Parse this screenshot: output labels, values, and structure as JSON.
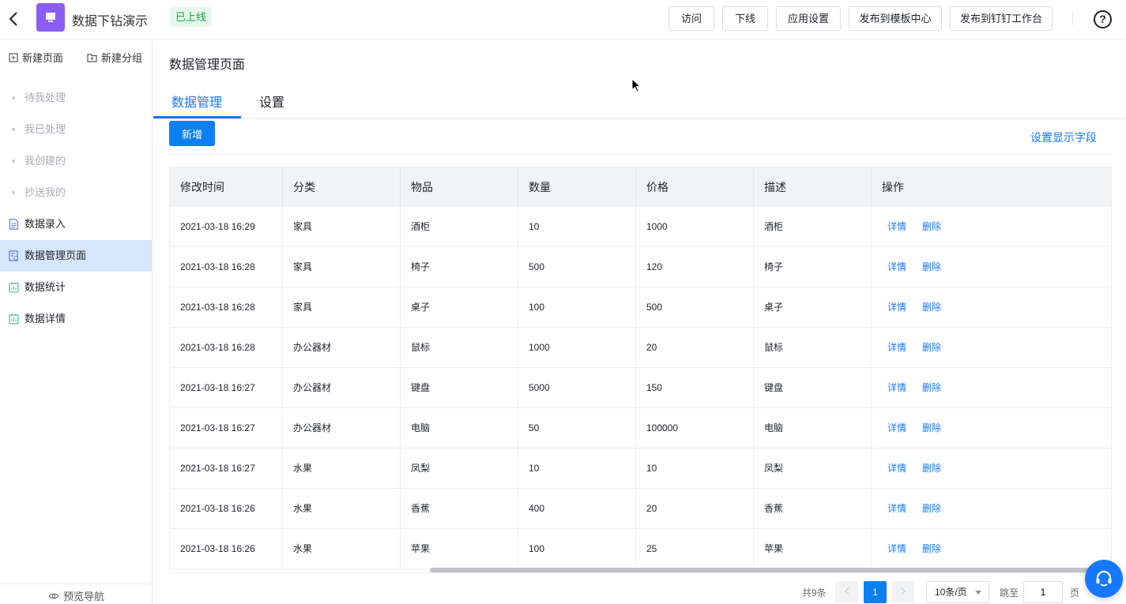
{
  "header": {
    "app_title": "数据下钻演示",
    "status": "已上线",
    "buttons": [
      "访问",
      "下线",
      "应用设置",
      "发布到模板中心",
      "发布到钉钉工作台"
    ]
  },
  "sidebar": {
    "new_page": "新建页面",
    "new_group": "新建分组",
    "items": [
      {
        "label": "待我处理",
        "muted": true
      },
      {
        "label": "我已处理",
        "muted": true
      },
      {
        "label": "我创建的",
        "muted": true
      },
      {
        "label": "抄送我的",
        "muted": true
      },
      {
        "label": "数据录入",
        "icon": "form-icon"
      },
      {
        "label": "数据管理页面",
        "icon": "data-manage-icon",
        "active": true
      },
      {
        "label": "数据统计",
        "icon": "report-icon"
      },
      {
        "label": "数据详情",
        "icon": "report-icon"
      }
    ],
    "footer": "预览导航"
  },
  "main": {
    "page_title": "数据管理页面",
    "tabs": [
      "数据管理",
      "设置"
    ],
    "add_button": "新增",
    "field_settings_link": "设置显示字段"
  },
  "table": {
    "columns": [
      "修改时间",
      "分类",
      "物品",
      "数量",
      "价格",
      "描述",
      "操作"
    ],
    "rows": [
      [
        "2021-03-18 16:29",
        "家具",
        "酒柜",
        "10",
        "1000",
        "酒柜"
      ],
      [
        "2021-03-18 16:28",
        "家具",
        "椅子",
        "500",
        "120",
        "椅子"
      ],
      [
        "2021-03-18 16:28",
        "家具",
        "桌子",
        "100",
        "500",
        "桌子"
      ],
      [
        "2021-03-18 16:28",
        "办公器材",
        "鼠标",
        "1000",
        "20",
        "鼠标"
      ],
      [
        "2021-03-18 16:27",
        "办公器材",
        "键盘",
        "5000",
        "150",
        "键盘"
      ],
      [
        "2021-03-18 16:27",
        "办公器材",
        "电脑",
        "50",
        "100000",
        "电脑"
      ],
      [
        "2021-03-18 16:27",
        "水果",
        "凤梨",
        "10",
        "10",
        "凤梨"
      ],
      [
        "2021-03-18 16:26",
        "水果",
        "香蕉",
        "400",
        "20",
        "香蕉"
      ],
      [
        "2021-03-18 16:26",
        "水果",
        "苹果",
        "100",
        "25",
        "苹果"
      ]
    ],
    "action_detail": "详情",
    "action_delete": "删除"
  },
  "pagination": {
    "total": "共9条",
    "current_page": "1",
    "page_size": "10条/页",
    "jump_label": "跳至",
    "jump_value": "1",
    "page_suffix": "页"
  },
  "colors": {
    "primary": "#1677ff",
    "app_icon": "#8b5cf6",
    "status_green": "#16a34a"
  }
}
